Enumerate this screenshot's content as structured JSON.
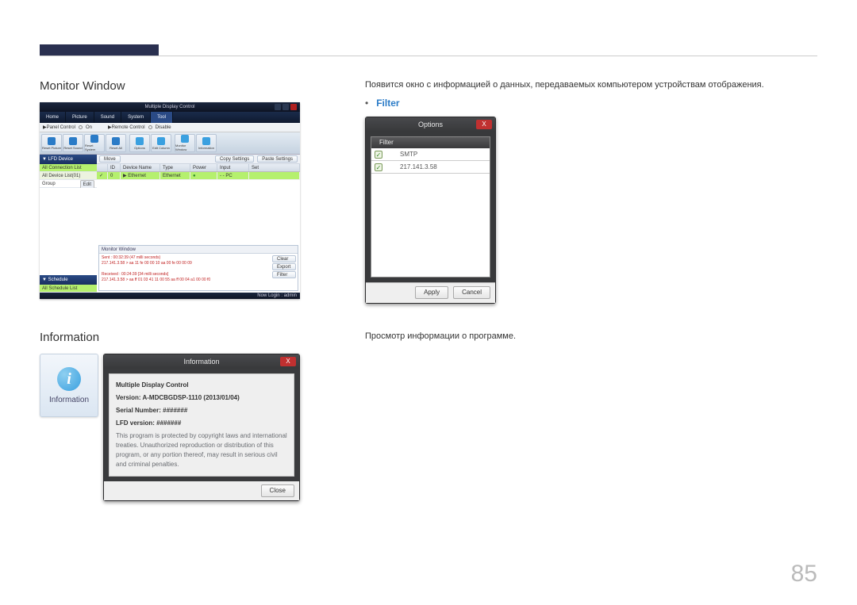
{
  "page_number": "85",
  "section1": {
    "title": "Monitor Window",
    "desc": "Появится окно с информацией о данных, передаваемых компьютером устройствам отображения.",
    "bullet": "Filter"
  },
  "section2": {
    "title": "Information",
    "desc": "Просмотр информации о программе."
  },
  "mdc": {
    "title": "Multiple Display Control",
    "tabs": [
      "Home",
      "Picture",
      "Sound",
      "System",
      "Tool"
    ],
    "settings": {
      "panel_label": "▶Panel Control",
      "panel_value": "On",
      "remote_label": "▶Remote Control",
      "remote_value": "Disable"
    },
    "toolbar": [
      "Reset Picture",
      "Reset Sound",
      "Reset System",
      "Reset All",
      "Options",
      "Edit Column",
      "Monitor Window",
      "Information"
    ],
    "topbar": {
      "move": "Move",
      "copy": "Copy Settings",
      "paste": "Paste Settings"
    },
    "side": {
      "lfd_header": "▼ LFD Device",
      "all_conn": "All Connection List",
      "all_dev": "All Device List(01)",
      "group": "Group",
      "edit": "Edit",
      "sched_header": "▼ Schedule",
      "all_sched": "All Schedule List"
    },
    "table": {
      "headers": [
        "",
        "ID",
        "Device Name",
        "Type",
        "Power",
        "Input",
        "Set"
      ],
      "row": {
        "id": "0",
        "name": "▶ Ethernet",
        "type": "Ethernet",
        "power": "●",
        "input": "- - PC",
        "set": ""
      }
    },
    "monitor": {
      "title": "Monitor Window",
      "line1": "Sent : 00:32:39 (47 milli seconds)",
      "line2": "217.141.3.58 > aa 11 fe 00 00 10 aa 00 fe 00 00 09",
      "line3": "Received : 00:24:39 [34 milli seconds]",
      "line4": "217.141.3.58 > aa ff 01 03 41 11 00 55 aa ff 00 04 a1 00 00 f0",
      "btn_clear": "Clear",
      "btn_export": "Export",
      "btn_filter": "Filter"
    },
    "status": "Now Login : admin"
  },
  "options": {
    "title": "Options",
    "col": "Filter",
    "row1": "SMTP",
    "row2": "217.141.3.58",
    "apply": "Apply",
    "cancel": "Cancel"
  },
  "info": {
    "tile_label": "Information",
    "title": "Information",
    "heading": "Multiple Display Control",
    "version": "Version: A-MDCBGDSP-1110 (2013/01/04)",
    "serial": "Serial Number: #######",
    "lfd": "LFD version: #######",
    "legal": "This program is protected by copyright laws and international treaties. Unauthorized reproduction or distribution of this program, or any portion thereof, may result in serious civil and criminal penalties.",
    "close": "Close"
  }
}
